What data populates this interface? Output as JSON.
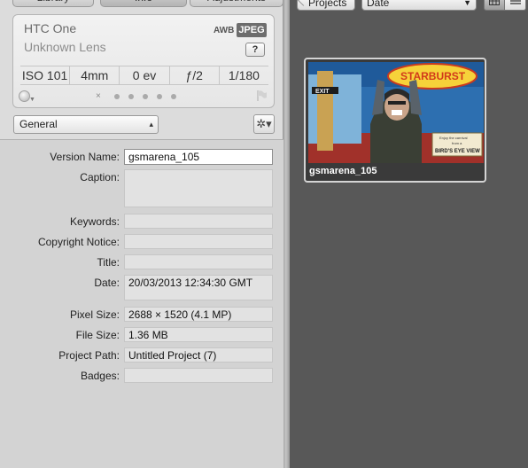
{
  "tabs": [
    {
      "label": "Library"
    },
    {
      "label": "Info"
    },
    {
      "label": "Adjustments"
    }
  ],
  "exif": {
    "camera": "HTC One",
    "lens": "Unknown Lens",
    "awb": "AWB",
    "format": "JPEG",
    "help": "?",
    "iso": "ISO 101",
    "focal": "4mm",
    "ev": "0 ev",
    "aperture": "ƒ/2",
    "shutter": "1/180",
    "reject": "×",
    "rating_stars": 0
  },
  "preset": {
    "selected": "General",
    "gear": "✲▾"
  },
  "metadata": {
    "version_name": {
      "label": "Version Name:",
      "value": "gsmarena_105"
    },
    "caption": {
      "label": "Caption:",
      "value": ""
    },
    "keywords": {
      "label": "Keywords:",
      "value": ""
    },
    "copyright": {
      "label": "Copyright Notice:",
      "value": ""
    },
    "title": {
      "label": "Title:",
      "value": ""
    },
    "date": {
      "label": "Date:",
      "value": "20/03/2013 12:34:30 GMT"
    },
    "pixel_size": {
      "label": "Pixel Size:",
      "value": "2688 × 1520 (4.1 MP)"
    },
    "file_size": {
      "label": "File Size:",
      "value": "1.36 MB"
    },
    "project_path": {
      "label": "Project Path:",
      "value": "Untitled Project (7)"
    },
    "badges": {
      "label": "Badges:",
      "value": ""
    }
  },
  "browser": {
    "projects_button": "Projects",
    "sort_by": "Date",
    "grid_view_icon": "grid-icon",
    "list_view_icon": "list-icon",
    "thumbnail": {
      "name": "gsmarena_105",
      "sign_text": "STARBURST",
      "exit_text": "EXIT",
      "board_text_1": "Enjoy the carnival",
      "board_text_2": "from a",
      "board_text_3": "BIRD'S EYE VIEW"
    }
  },
  "colors": {
    "panel_bg": "#dcdcdc",
    "browser_bg": "#585858",
    "format_badge": "#6d6d6d"
  }
}
